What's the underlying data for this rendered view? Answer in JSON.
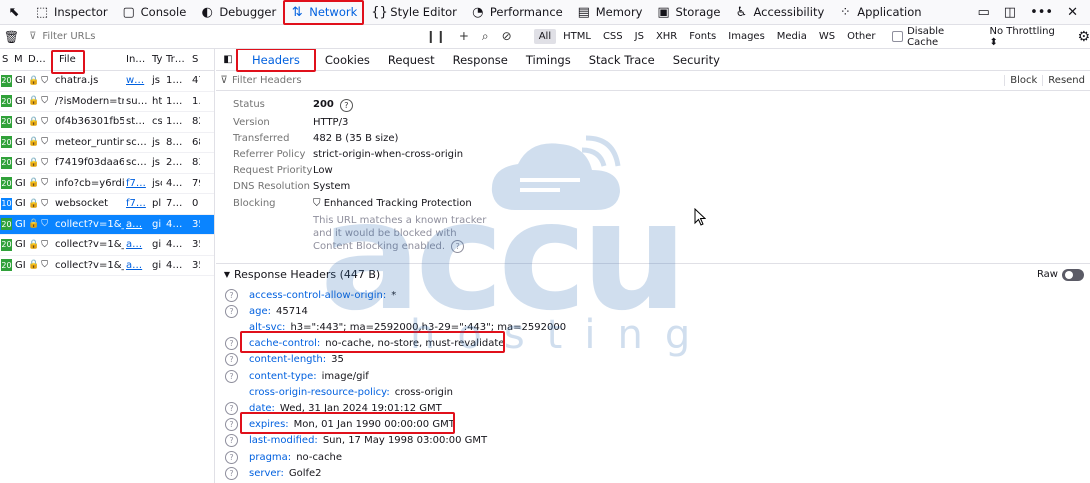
{
  "toolbar": {
    "tools": [
      {
        "label": "Inspector",
        "icon": "⬚"
      },
      {
        "label": "Console",
        "icon": "▢"
      },
      {
        "label": "Debugger",
        "icon": "◐"
      },
      {
        "label": "Network",
        "icon": "⇅"
      },
      {
        "label": "Style Editor",
        "icon": "{}"
      },
      {
        "label": "Performance",
        "icon": "◔"
      },
      {
        "label": "Memory",
        "icon": "▤"
      },
      {
        "label": "Storage",
        "icon": "▣"
      },
      {
        "label": "Accessibility",
        "icon": "♿"
      },
      {
        "label": "Application",
        "icon": "⁘"
      }
    ],
    "active": "Network"
  },
  "filterbar": {
    "placeholder": "Filter URLs",
    "types": [
      "All",
      "HTML",
      "CSS",
      "JS",
      "XHR",
      "Fonts",
      "Images",
      "Media",
      "WS",
      "Other"
    ],
    "selected_type": "All",
    "disable_cache": "Disable Cache",
    "throttling": "No Throttling ⬍"
  },
  "request_list": {
    "headers": [
      "S",
      "M",
      "D…",
      "File",
      "In…",
      "Ty",
      "Tr…",
      "S"
    ],
    "rows": [
      {
        "status": "20",
        "method": "GI",
        "file": "chatra.js",
        "initiator": "w…",
        "type": "js",
        "transferred": "1…",
        "size": "47",
        "initiator_link": true
      },
      {
        "status": "20",
        "method": "GI",
        "file": "/?isModern=true",
        "initiator": "su…",
        "type": "ht",
        "transferred": "1…",
        "size": "1.",
        "initiator_link": false
      },
      {
        "status": "20",
        "method": "GI",
        "file": "0f4b36301fb5",
        "initiator": "st…",
        "type": "cs",
        "transferred": "1…",
        "size": "82",
        "initiator_link": false
      },
      {
        "status": "20",
        "method": "GI",
        "file": "meteor_runtim",
        "initiator": "sc…",
        "type": "js",
        "transferred": "8…",
        "size": "68",
        "initiator_link": false
      },
      {
        "status": "20",
        "method": "GI",
        "file": "f7419f03daa6",
        "initiator": "sc…",
        "type": "js",
        "transferred": "2…",
        "size": "83",
        "initiator_link": false
      },
      {
        "status": "20",
        "method": "GI",
        "file": "info?cb=y6rdi",
        "initiator": "f7…",
        "type": "jsc",
        "transferred": "4…",
        "size": "79",
        "initiator_link": true
      },
      {
        "status": "10",
        "method": "GI",
        "file": "websocket",
        "initiator": "f7…",
        "type": "pl",
        "transferred": "7…",
        "size": "0",
        "initiator_link": true
      },
      {
        "status": "20",
        "method": "GI",
        "file": "collect?v=1&_",
        "initiator": "a…",
        "type": "gi",
        "transferred": "4…",
        "size": "35",
        "initiator_link": true,
        "selected": true
      },
      {
        "status": "20",
        "method": "GI",
        "file": "collect?v=1&_",
        "initiator": "a…",
        "type": "gi",
        "transferred": "4…",
        "size": "35",
        "initiator_link": true
      },
      {
        "status": "20",
        "method": "GI",
        "file": "collect?v=1&_",
        "initiator": "a…",
        "type": "gi",
        "transferred": "4…",
        "size": "35",
        "initiator_link": true
      }
    ]
  },
  "details": {
    "tabs": [
      "Headers",
      "Cookies",
      "Request",
      "Response",
      "Timings",
      "Stack Trace",
      "Security"
    ],
    "active_tab": "Headers",
    "filter_placeholder": "Filter Headers",
    "buttons": [
      "Block",
      "Resend"
    ],
    "summary": {
      "status_label": "Status",
      "status_value": "200",
      "version_label": "Version",
      "version_value": "HTTP/3",
      "transferred_label": "Transferred",
      "transferred_value": "482 B (35 B size)",
      "referrer_label": "Referrer Policy",
      "referrer_value": "strict-origin-when-cross-origin",
      "priority_label": "Request Priority",
      "priority_value": "Low",
      "dns_label": "DNS Resolution",
      "dns_value": "System",
      "blocking_label": "Blocking",
      "blocking_value": "Enhanced Tracking Protection",
      "blocking_note_1": "This URL matches a known tracker",
      "blocking_note_2": "and it would be blocked with",
      "blocking_note_3": "Content Blocking enabled."
    },
    "response_headers_title": "Response Headers (447 B)",
    "raw_label": "Raw",
    "response_headers": [
      {
        "name": "access-control-allow-origin:",
        "value": "*",
        "help": true
      },
      {
        "name": "age:",
        "value": "45714",
        "help": true
      },
      {
        "name": "alt-svc:",
        "value": "h3=\":443\"; ma=2592000,h3-29=\":443\"; ma=2592000",
        "help": false
      },
      {
        "name": "cache-control:",
        "value": "no-cache, no-store, must-revalidate",
        "help": true
      },
      {
        "name": "content-length:",
        "value": "35",
        "help": true
      },
      {
        "name": "content-type:",
        "value": "image/gif",
        "help": true
      },
      {
        "name": "cross-origin-resource-policy:",
        "value": "cross-origin",
        "help": false
      },
      {
        "name": "date:",
        "value": "Wed, 31 Jan 2024 19:01:12 GMT",
        "help": true
      },
      {
        "name": "expires:",
        "value": "Mon, 01 Jan 1990 00:00:00 GMT",
        "help": true
      },
      {
        "name": "last-modified:",
        "value": "Sun, 17 May 1998 03:00:00 GMT",
        "help": true
      },
      {
        "name": "pragma:",
        "value": "no-cache",
        "help": true
      },
      {
        "name": "server:",
        "value": "Golfe2",
        "help": true
      }
    ]
  },
  "watermark": {
    "line1": "accu",
    "line2": "hosting"
  },
  "colors": {
    "accent": "#0060df",
    "highlight": "#e0101b",
    "selected_row": "#0a84ff",
    "status_ok": "#30a13a"
  }
}
